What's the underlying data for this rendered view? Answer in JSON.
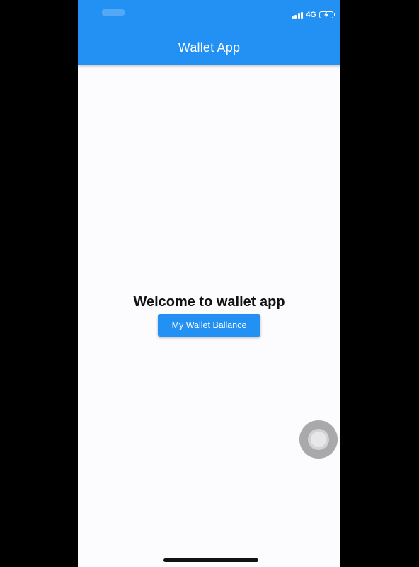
{
  "status_bar": {
    "network": "4G",
    "icons": [
      "signal-icon",
      "battery-charging-icon"
    ]
  },
  "app_bar": {
    "title": "Wallet App",
    "color": "#2391f3"
  },
  "main": {
    "welcome_text": "Welcome to wallet app",
    "balance_button_label": "My Wallet Ballance"
  },
  "overlay": {
    "icons": [
      "assistive-touch-icon"
    ]
  },
  "colors": {
    "primary": "#2391f3",
    "background": "#fcfbfe",
    "text": "#111111"
  }
}
